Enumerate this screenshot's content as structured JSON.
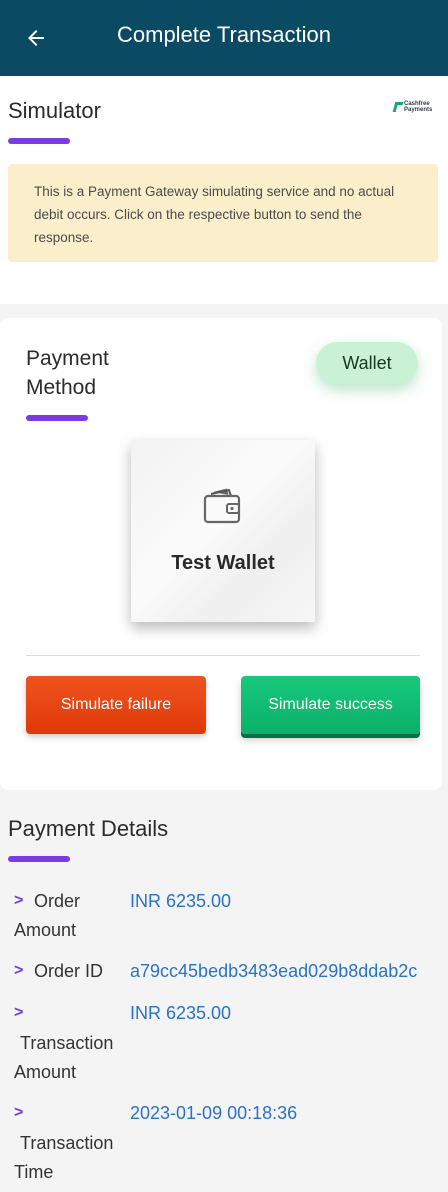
{
  "header": {
    "title": "Complete Transaction",
    "back_icon": "arrow-left-icon"
  },
  "simulator": {
    "title": "Simulator",
    "logo_text_1": "Cashfree",
    "logo_text_2": "Payments",
    "notice": "This is a Payment Gateway simulating service and no actual debit occurs. Click on the respective button to send the response."
  },
  "payment_method": {
    "title_line1": "Payment",
    "title_line2": "Method",
    "chip_label": "Wallet",
    "card_label": "Test Wallet",
    "card_icon": "wallet-icon",
    "fail_label": "Simulate failure",
    "success_label": "Simulate success"
  },
  "payment_details": {
    "title": "Payment Details",
    "rows": [
      {
        "arrow": ">",
        "label_1": "Order",
        "label_2": "Amount",
        "value": "INR 6235.00"
      },
      {
        "arrow": ">",
        "label_1": "Order ID",
        "value": "a79cc45bedb3483ead029b8ddab2c"
      },
      {
        "arrow": ">",
        "label_1": "Transaction",
        "label_2": "Amount",
        "value": "INR 6235.00"
      },
      {
        "arrow": ">",
        "label_1": "Transaction",
        "label_2": "Time",
        "value": "2023-01-09 00:18:36"
      }
    ]
  },
  "colors": {
    "appbar": "#0b4a63",
    "accent_purple": "#7a3ce0",
    "fail": "#e8460f",
    "success": "#13bd74",
    "link_value": "#2a72c4",
    "notice_bg": "#fbefcb"
  }
}
